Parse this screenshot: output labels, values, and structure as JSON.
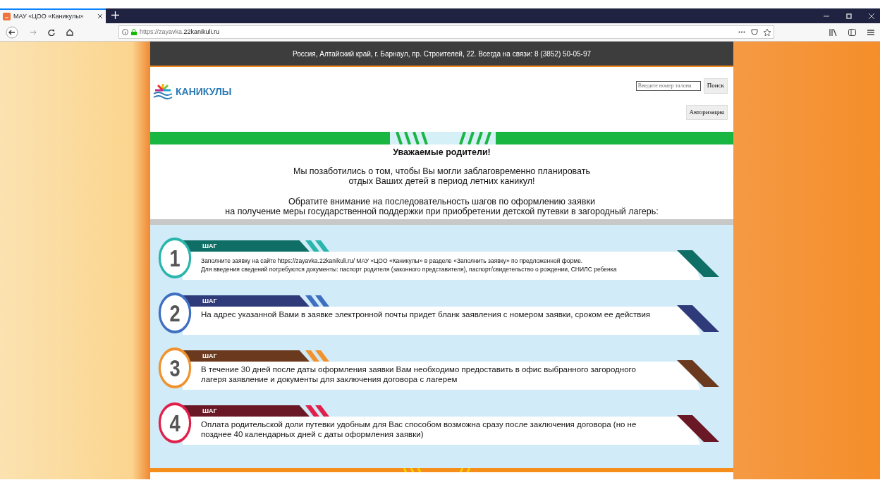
{
  "browser": {
    "tab_title": "МАУ «ЦОО «Каникулы»",
    "url_prefix": "https://zayavka.",
    "url_domain": "22kanikuli.ru"
  },
  "topbar": {
    "text": "Россия, Алтайский край, г. Барнаул, пр. Строителей, 22.  Всегда на связи: 8 (3852) 50-05-97"
  },
  "header": {
    "logo_text": "КАНИКУЛЫ",
    "search": {
      "placeholder": "Введите номер талона"
    },
    "search_button": "Поиск",
    "login_button": "Авторизация"
  },
  "intro": {
    "title": "Уважаемые родители!",
    "paragraphs": [
      [
        "Мы позаботились о том, чтобы Вы могли заблаговременно планировать",
        "отдых Ваших детей в период летних каникул!"
      ],
      [
        "Обратите внимание на последовательность шагов по оформлению заявки",
        "на получение меры государственной поддержки  при приобретении детской путевки в загородный лагерь:"
      ]
    ]
  },
  "steps": [
    {
      "number": "1",
      "label": "ШАГ",
      "color": "#0f6e66",
      "accent": {
        "color": "#2ab5ad"
      },
      "small": true,
      "lines": [
        "Заполните заявку на сайте https://zayavka.22kanikuli.ru/ МАУ «ЦОО «Каникулы» в разделе «Заполнить заявку» по предложенной форме.",
        "Для введения сведений потребуются документы: паспорт родителя (законного представителя), паспорт/свидетельство о рождении, СНИЛС ребенка"
      ]
    },
    {
      "number": "2",
      "label": "ШАГ",
      "color": "#2e3a7a",
      "accent": {
        "color": "#3f6fc0"
      },
      "small": false,
      "lines": [
        "На адрес указанной Вами в заявке электронной почты придет бланк заявления с номером заявки, сроком ее действия"
      ]
    },
    {
      "number": "3",
      "label": "ШАГ",
      "color": "#6b3a1e",
      "accent": {
        "color": "#f0922e"
      },
      "small": false,
      "lines": [
        "В течение 30 дней после даты оформления заявки Вам необходимо предоставить в офис выбранного загородного",
        "лагеря заявление и документы для заключения договора с лагерем"
      ]
    },
    {
      "number": "4",
      "label": "ШАГ",
      "color": "#6a1826",
      "accent": {
        "color": "#e0204a"
      },
      "small": false,
      "lines": [
        "Оплата родительской доли путевки удобным для Вас способом возможна сразу после заключения договора (но не",
        "позднее 40 календарных дней с даты оформления заявки)"
      ]
    }
  ]
}
